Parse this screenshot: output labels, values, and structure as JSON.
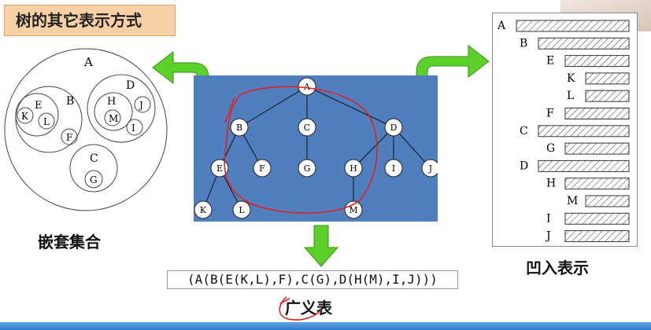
{
  "title": "树的其它表示方式",
  "labels": {
    "nested": "嵌套集合",
    "indent": "凹入表示",
    "general_list": "广义表"
  },
  "general_list_text": "(A(B(E(K,L),F),C(G),D(H(M),I,J)))",
  "nested": {
    "outer": "A",
    "B": "B",
    "E": "E",
    "K": "K",
    "L": "L",
    "F": "F",
    "D": "D",
    "H": "H",
    "M": "M",
    "J": "J",
    "I": "I",
    "C": "C",
    "G": "G"
  },
  "tree_nodes": [
    "A",
    "B",
    "C",
    "D",
    "E",
    "F",
    "G",
    "H",
    "I",
    "J",
    "K",
    "L",
    "M"
  ],
  "indent_rows": [
    {
      "label": "A"
    },
    {
      "label": "B"
    },
    {
      "label": "E"
    },
    {
      "label": "K"
    },
    {
      "label": "L"
    },
    {
      "label": "F"
    },
    {
      "label": "C"
    },
    {
      "label": "G"
    },
    {
      "label": "D"
    },
    {
      "label": "H"
    },
    {
      "label": "M"
    },
    {
      "label": "I"
    },
    {
      "label": "J"
    }
  ],
  "colors": {
    "title_bg": "#f8d0a6",
    "tree_bg": "#4f7fbf",
    "arrow": "#5cd12a",
    "annotation": "#e02020"
  }
}
